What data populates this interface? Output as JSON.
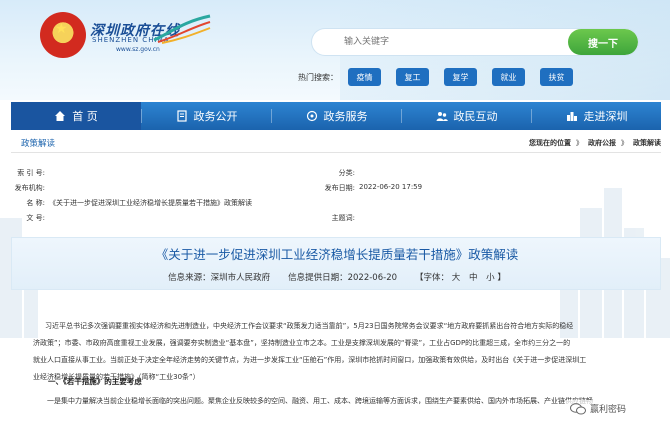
{
  "header": {
    "logo_title": "深圳政府在线",
    "logo_sub": "SHENZHEN CHINA",
    "logo_url": "www.sz.gov.cn",
    "search_placeholder": "输入关键字",
    "search_button": "搜一下",
    "hot_label": "热门搜索：",
    "hot_tags": [
      "疫情",
      "复工",
      "复学",
      "就业",
      "扶贫"
    ]
  },
  "nav": {
    "items": [
      {
        "label": "首 页",
        "icon": "home-icon"
      },
      {
        "label": "政务公开",
        "icon": "document-icon"
      },
      {
        "label": "政务服务",
        "icon": "service-icon"
      },
      {
        "label": "政民互动",
        "icon": "interaction-icon"
      },
      {
        "label": "走进深圳",
        "icon": "city-icon"
      }
    ]
  },
  "breadcrumb": {
    "section": "政策解读",
    "prefix": "您现在的位置",
    "sep": "》",
    "path": [
      "政府公报",
      "政策解读"
    ]
  },
  "info": {
    "index_label": "索 引 号:",
    "index_value": "",
    "classify_label": "分类:",
    "classify_value": "",
    "issuer_label": "发布机构:",
    "issuer_value": "",
    "date_label": "发布日期:",
    "date_value": "2022-06-20 17:59",
    "name_label": "名   称:",
    "name_value": "《关于进一步促进深圳工业经济稳增长提质量若干措施》政策解读",
    "docno_label": "文 号:",
    "docno_value": "",
    "subject_label": "主题词:",
    "subject_value": ""
  },
  "doc": {
    "title": "《关于进一步促进深圳工业经济稳增长提质量若干措施》政策解读",
    "source": "信息来源：深圳市人民政府",
    "date": "信息提供日期：2022-06-20",
    "font_label": "【字体：",
    "font_large": "大",
    "font_medium": "中",
    "font_small": "小",
    "font_end": "】"
  },
  "body": {
    "para1_line1": "习近平总书记多次强调要重视实体经济和先进制造业，中央经济工作会议要求“政策发力适当靠前”，5月23日国务院常务会议要求“地方政府要抓紧出台符合地方实际的稳经",
    "para1_line2": "济政策”；市委、市政府高度重视工业发展，强调要夯实制造业“基本盘”，坚持制造业立市之本。工业是支撑深圳发展的“脊梁”，工业占GDP的比重超三成，全市约三分之一的",
    "para1_line3": "就业人口直接从事工业。当前正处于决定全年经济走势的关键节点，为进一步发挥工业“压舱石”作用，深圳市抢抓时间窗口，加强政策有效供给，及时出台《关于进一步促进深圳工",
    "para1_line4": "业经济稳增长提质量的若干措施》（简称“工业30条”）",
    "section1": "一、《若干措施》的主要考虑",
    "para2": "一是集中力量解决当前企业稳增长面临的突出问题。聚焦企业反映较多的空间、融资、用工、成本、跨境运输等方面诉求，围绕生产要素供给、国内外市场拓展、产业链供应链畅"
  },
  "watermark": {
    "text": "赢利密码"
  },
  "colors": {
    "nav": "#1b63ad",
    "nav_active": "#1a55a0",
    "title": "#1a5aa5",
    "search_button": "#3ea53b",
    "hot_tag": "#1f6fc0"
  }
}
